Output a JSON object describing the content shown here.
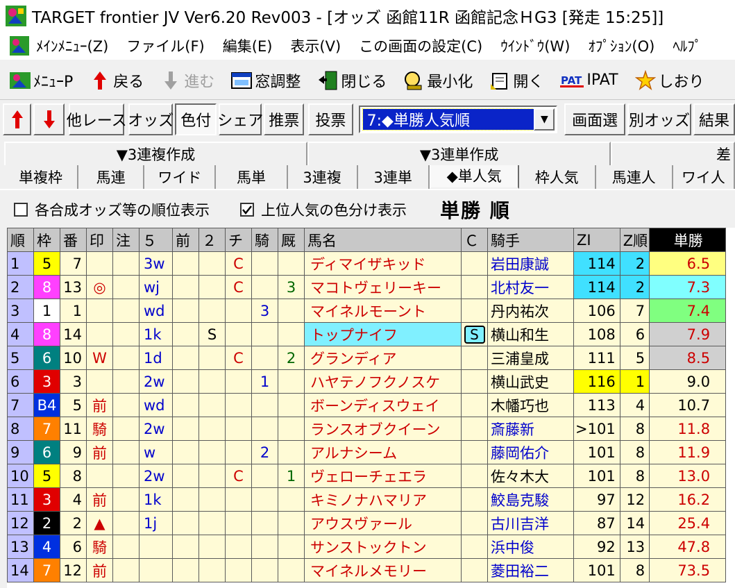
{
  "window": {
    "title": "TARGET frontier JV  Ver6.20  Rev003 - [オッズ 函館11R 函館記念ＨG3  [発走 15:25]]"
  },
  "menubar": {
    "items": [
      "ﾒｲﾝﾒﾆｭｰ(Z)",
      "ファイル(F)",
      "編集(E)",
      "表示(V)",
      "この画面の設定(C)",
      "ｳｲﾝﾄﾞｳ(W)",
      "ｵﾌﾟｼｮﾝ(O)",
      "ﾍﾙﾌﾟ"
    ]
  },
  "toolbar1": {
    "menu_p": "ﾒﾆｭｰP",
    "back": "戻る",
    "forward": "進む",
    "window_adjust": "窓調整",
    "close": "閉じる",
    "minimize": "最小化",
    "open": "開く",
    "pat_icon": "PAT",
    "ipat": "IPAT",
    "bookmark": "しおり"
  },
  "toolbar2": {
    "other_race": "他レース",
    "odds": "オッズ",
    "coloring": "色付",
    "share": "シェア",
    "recommend": "推票",
    "vote": "投票",
    "sort_selected": "7:◆単勝人気順",
    "screen_select": "画面選",
    "other_odds": "別オッズ",
    "result": "結果"
  },
  "tabs_top": [
    "▼3連複作成",
    "▼3連単作成",
    "差"
  ],
  "tabs_bottom": [
    "単複枠",
    "馬連",
    "ワイド",
    "馬単",
    "3連複",
    "3連単",
    "◆単人気",
    "枠人気",
    "馬連人",
    "ワイ人"
  ],
  "tabs_bottom_active": "◆単人気",
  "options": {
    "rank_display_label": "各合成オッズ等の順位表示",
    "rank_display_checked": false,
    "color_split_label": "上位人気の色分け表示",
    "color_split_checked": true,
    "heading": "単勝 順"
  },
  "table": {
    "headers": [
      "順",
      "枠",
      "番",
      "印",
      "注",
      "５",
      "前",
      "２",
      "チ",
      "騎",
      "厩",
      "馬名",
      "Ｃ",
      "騎手",
      "ZI",
      "Z順",
      "単勝"
    ],
    "rows": [
      {
        "rank": "1",
        "waku": "5",
        "ban": "7",
        "mark": "",
        "chu": "",
        "five": "3w",
        "mae": "",
        "two": "",
        "chi": "C",
        "ki": "",
        "kyu": "",
        "horse": "ディマイザキッド",
        "c": "",
        "jockey": "岩田康誠",
        "zi": "114",
        "zrank": "2",
        "odds": "6.5"
      },
      {
        "rank": "2",
        "waku": "8",
        "ban": "13",
        "mark": "◎",
        "chu": "",
        "five": "wj",
        "mae": "",
        "two": "",
        "chi": "C",
        "ki": "",
        "kyu": "3",
        "horse": "マコトヴェリーキー",
        "c": "",
        "jockey": "北村友一",
        "zi": "114",
        "zrank": "2",
        "odds": "7.3"
      },
      {
        "rank": "3",
        "waku": "1",
        "ban": "1",
        "mark": "",
        "chu": "",
        "five": "wd",
        "mae": "",
        "two": "",
        "chi": "",
        "ki": "3",
        "kyu": "",
        "horse": "マイネルモーント",
        "c": "",
        "jockey": "丹内祐次",
        "zi": "106",
        "zrank": "7",
        "odds": "7.4"
      },
      {
        "rank": "4",
        "waku": "8",
        "ban": "14",
        "mark": "",
        "chu": "",
        "five": "1k",
        "mae": "",
        "two": "S",
        "chi": "",
        "ki": "",
        "kyu": "",
        "horse": "トップナイフ",
        "c": "S",
        "jockey": "横山和生",
        "zi": "108",
        "zrank": "6",
        "odds": "7.9"
      },
      {
        "rank": "5",
        "waku": "6",
        "ban": "10",
        "mark": "W",
        "chu": "",
        "five": "1d",
        "mae": "",
        "two": "",
        "chi": "C",
        "ki": "",
        "kyu": "2",
        "horse": "グランディア",
        "c": "",
        "jockey": "三浦皇成",
        "zi": "111",
        "zrank": "5",
        "odds": "8.5"
      },
      {
        "rank": "6",
        "waku": "3",
        "ban": "3",
        "mark": "",
        "chu": "",
        "five": "2w",
        "mae": "",
        "two": "",
        "chi": "",
        "ki": "1",
        "kyu": "",
        "horse": "ハヤテノフクノスケ",
        "c": "",
        "jockey": "横山武史",
        "zi": "116",
        "zrank": "1",
        "odds": "9.0"
      },
      {
        "rank": "7",
        "waku": "B4",
        "ban": "5",
        "mark": "前",
        "chu": "",
        "five": "wd",
        "mae": "",
        "two": "",
        "chi": "",
        "ki": "",
        "kyu": "",
        "horse": "ボーンディスウェイ",
        "c": "",
        "jockey": "木幡巧也",
        "zi": "113",
        "zrank": "4",
        "odds": "10.7"
      },
      {
        "rank": "8",
        "waku": "7",
        "ban": "11",
        "mark": "騎",
        "chu": "",
        "five": "2w",
        "mae": "",
        "two": "",
        "chi": "",
        "ki": "",
        "kyu": "",
        "horse": "ランスオブクイーン",
        "c": "",
        "jockey": "斎藤新",
        "zi": ">101",
        "zrank": "8",
        "odds": "11.8"
      },
      {
        "rank": "9",
        "waku": "6",
        "ban": "9",
        "mark": "前",
        "chu": "",
        "five": "w",
        "mae": "",
        "two": "",
        "chi": "",
        "ki": "2",
        "kyu": "",
        "horse": "アルナシーム",
        "c": "",
        "jockey": "藤岡佑介",
        "zi": "101",
        "zrank": "8",
        "odds": "11.9"
      },
      {
        "rank": "10",
        "waku": "5",
        "ban": "8",
        "mark": "",
        "chu": "",
        "five": "2w",
        "mae": "",
        "two": "",
        "chi": "C",
        "ki": "",
        "kyu": "1",
        "horse": "ヴェローチェエラ",
        "c": "",
        "jockey": "佐々木大",
        "zi": "101",
        "zrank": "8",
        "odds": "13.0"
      },
      {
        "rank": "11",
        "waku": "3",
        "ban": "4",
        "mark": "前",
        "chu": "",
        "five": "1k",
        "mae": "",
        "two": "",
        "chi": "",
        "ki": "",
        "kyu": "",
        "horse": "キミノナハマリア",
        "c": "",
        "jockey": "鮫島克駿",
        "zi": "97",
        "zrank": "12",
        "odds": "16.2"
      },
      {
        "rank": "12",
        "waku": "2",
        "ban": "2",
        "mark": "▲",
        "chu": "",
        "five": "1j",
        "mae": "",
        "two": "",
        "chi": "",
        "ki": "",
        "kyu": "",
        "horse": "アウスヴァール",
        "c": "",
        "jockey": "古川吉洋",
        "zi": "87",
        "zrank": "14",
        "odds": "25.4"
      },
      {
        "rank": "13",
        "waku": "4",
        "ban": "6",
        "mark": "騎",
        "chu": "",
        "five": "",
        "mae": "",
        "two": "",
        "chi": "",
        "ki": "",
        "kyu": "",
        "horse": "サンストックトン",
        "c": "",
        "jockey": "浜中俊",
        "zi": "92",
        "zrank": "13",
        "odds": "47.8"
      },
      {
        "rank": "14",
        "waku": "7",
        "ban": "12",
        "mark": "前",
        "chu": "",
        "five": "",
        "mae": "",
        "two": "",
        "chi": "",
        "ki": "",
        "kyu": "",
        "horse": "マイネルメモリー",
        "c": "",
        "jockey": "菱田裕二",
        "zi": "101",
        "zrank": "8",
        "odds": "73.5"
      }
    ]
  },
  "colors": {
    "waku_1": "#ffffff",
    "waku_2": "#000000",
    "waku_3": "#e00000",
    "waku_4": "#0030e0",
    "waku_5": "#ffff00",
    "waku_6": "#008080",
    "waku_7": "#ff8000",
    "waku_8": "#ff40ff",
    "zi_top": "#40e0ff",
    "zi_best": "#ffff00",
    "odds_1": "#ffff80",
    "odds_2": "#80ffff",
    "odds_3": "#80ff80",
    "odds_4": "#d0d0d0"
  },
  "icons": {
    "up_arrow": "up-arrow-icon",
    "down_arrow": "down-arrow-icon"
  }
}
